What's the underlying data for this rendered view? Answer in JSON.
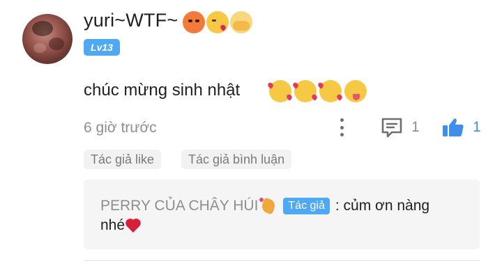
{
  "comment": {
    "avatar_alt": "avatar",
    "username": "yuri~WTF~",
    "username_emojis": [
      "hot-face-icon",
      "kissing-heart-icon",
      "peeking-face-icon"
    ],
    "level_badge": "Lv13",
    "text": "chúc mừng sinh nhật",
    "text_emojis": [
      "smiling-hearts-icon",
      "smiling-hearts-icon",
      "smiling-hearts-icon",
      "squinting-tongue-icon"
    ],
    "timestamp": "6 giờ trước",
    "reply_count": "1",
    "like_count": "1",
    "like_color": "#3f8fe8"
  },
  "chips": {
    "author_liked": "Tác giả like",
    "author_replied": "Tác giả bình luận"
  },
  "reply": {
    "author": "PERRY CỦA CHÂY HÚI",
    "author_badge": "Tác giả",
    "text_line1": ": củm ơn nàng",
    "text_line2": "nhé"
  },
  "colors": {
    "accent": "#4fa8f2",
    "muted_text": "#8e8e8e",
    "reply_bg": "#f5f5f5"
  }
}
